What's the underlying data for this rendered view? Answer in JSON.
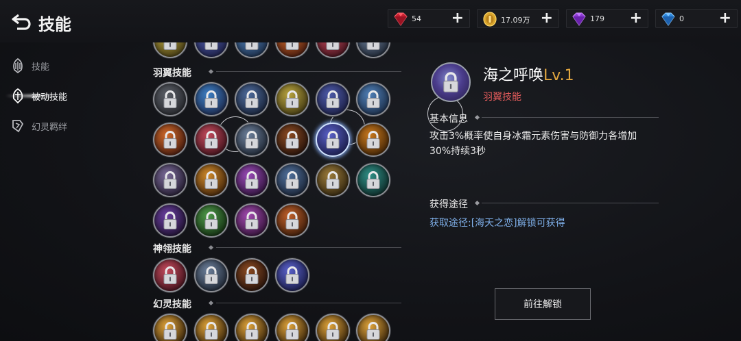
{
  "header": {
    "title": "技能",
    "back_icon": "back-arrow-icon"
  },
  "currencies": [
    {
      "name": "red-gem",
      "value": "54",
      "icon": "red-gem-icon",
      "color": "#d8283a"
    },
    {
      "name": "gold-coin",
      "value": "17.09万",
      "icon": "gold-coin-icon",
      "color": "#e2b23a"
    },
    {
      "name": "purple-gem",
      "value": "179",
      "icon": "purple-gem-icon",
      "color": "#a24ae6"
    },
    {
      "name": "blue-gem",
      "value": "0",
      "icon": "blue-diamond-icon",
      "color": "#3a9ef0"
    }
  ],
  "sidebar": {
    "items": [
      {
        "label": "技能",
        "icon": "skill-icon",
        "active": false
      },
      {
        "label": "被动技能",
        "icon": "passive-skill-icon",
        "active": true
      },
      {
        "label": "幻灵羁绊",
        "icon": "spirit-bond-icon",
        "active": false
      }
    ]
  },
  "skill_sections": [
    {
      "title": "羽翼技能",
      "count": 22
    },
    {
      "title": "神翎技能",
      "count": 4
    },
    {
      "title": "幻灵技能",
      "count": 6
    }
  ],
  "detail": {
    "name": "海之呼唤",
    "level": "Lv.1",
    "type": "羽翼技能",
    "basic_info_title": "基本信息",
    "description": "攻击3%概率使自身冰霜元素伤害与防御力各增加30%持续3秒",
    "acquire_title": "获得途径",
    "acquire_text": "获取途径:[海天之恋]解锁可获得",
    "unlock_button": "前往解锁"
  },
  "colors": {
    "accent_level": "#e3a73f",
    "type_red": "#e25b5b",
    "link_blue": "#7fb0ea"
  }
}
